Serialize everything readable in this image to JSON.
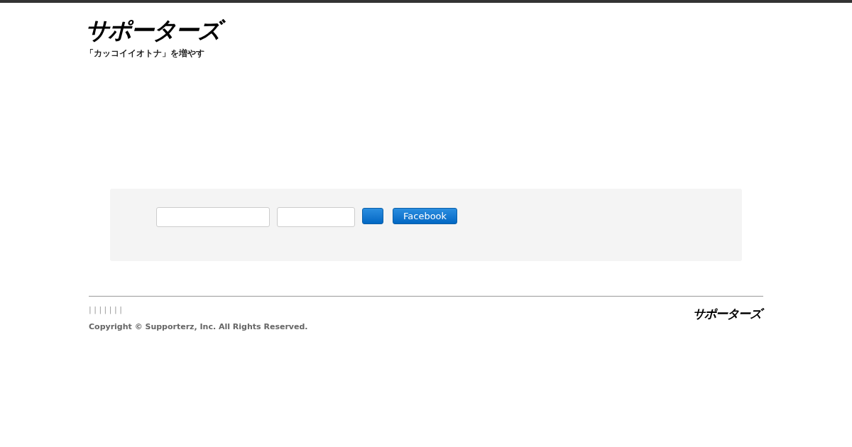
{
  "header": {
    "logo": "サポーターズ",
    "tagline": "「カッコイイオトナ」を増やす"
  },
  "login": {
    "fields": [
      {
        "kind": "email"
      },
      {
        "kind": "password"
      }
    ],
    "buttons": [
      {
        "kind": "submit"
      },
      {
        "kind": "facebook",
        "label": "Facebook"
      }
    ]
  },
  "footer": {
    "separators": "| | | | | | |",
    "copyright": "Copyright © Supporterz, Inc. All Rights Reserved.",
    "logo": "サポーターズ"
  }
}
